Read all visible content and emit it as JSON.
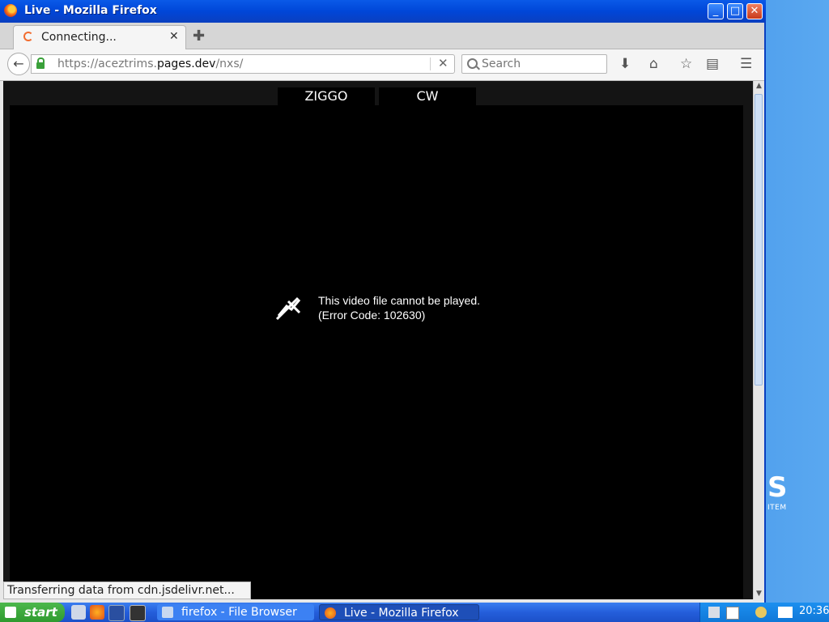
{
  "window": {
    "title": "Live - Mozilla Firefox",
    "minimize_icon": "minimize-icon",
    "maximize_icon": "maximize-icon",
    "close_icon": "close-icon"
  },
  "tabs": [
    {
      "label": "Connecting...",
      "loading": true,
      "close": "✕"
    }
  ],
  "new_tab_symbol": "✚",
  "navbar": {
    "url_prefix": "https://aceztrims.",
    "url_host": "pages.dev",
    "url_path": "/nxs/",
    "clear_symbol": "✕",
    "search_placeholder": "Search",
    "download_icon": "download-icon",
    "home_icon": "home-icon",
    "bookmark_icon": "star-icon",
    "reader_icon": "reading-list-icon",
    "menu_icon": "hamburger-menu-icon"
  },
  "page": {
    "channel_tabs": [
      "ZIGGO",
      "CW"
    ],
    "error_line1": "This video file cannot be played.",
    "error_line2": "(Error Code: 102630)"
  },
  "status_text": "Transferring data from cdn.jsdelivr.net...",
  "desktop": {
    "logo_big": "S",
    "logo_small": "ITEM"
  },
  "taskbar": {
    "start_label": "start",
    "tasks": [
      {
        "label": "firefox - File Browser"
      },
      {
        "label": "Live - Mozilla Firefox",
        "active": true
      }
    ],
    "clock": "20:36"
  },
  "colors": {
    "titlebar": "#0046d8",
    "taskbar": "#245edb",
    "start": "#2f9a2f",
    "video_bg": "#000000"
  }
}
